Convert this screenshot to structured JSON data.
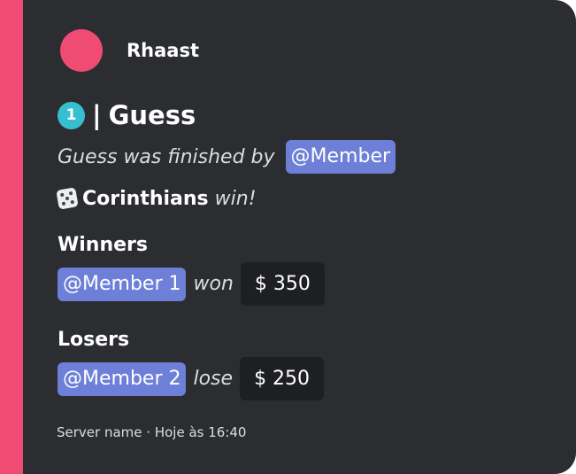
{
  "embed": {
    "accent_color": "#f04b72",
    "background_color": "#2b2d31",
    "author": {
      "name": "Rhaast",
      "avatar_color": "#f04b72"
    },
    "title": {
      "badge_number": "1",
      "separator": "|",
      "text": "Guess"
    },
    "finished": {
      "text": "Guess was finished by",
      "mention": "@Member"
    },
    "result": {
      "icon": "dice-icon",
      "team": "Corinthians",
      "word": "win!"
    },
    "winners": {
      "heading": "Winners",
      "mention": "@Member 1",
      "verb": "won",
      "amount": "$ 350"
    },
    "losers": {
      "heading": "Losers",
      "mention": "@Member 2",
      "verb": "lose",
      "amount": "$ 250"
    },
    "footer": {
      "server": "Server name",
      "separator": "·",
      "timestamp": "Hoje às 16:40"
    }
  }
}
